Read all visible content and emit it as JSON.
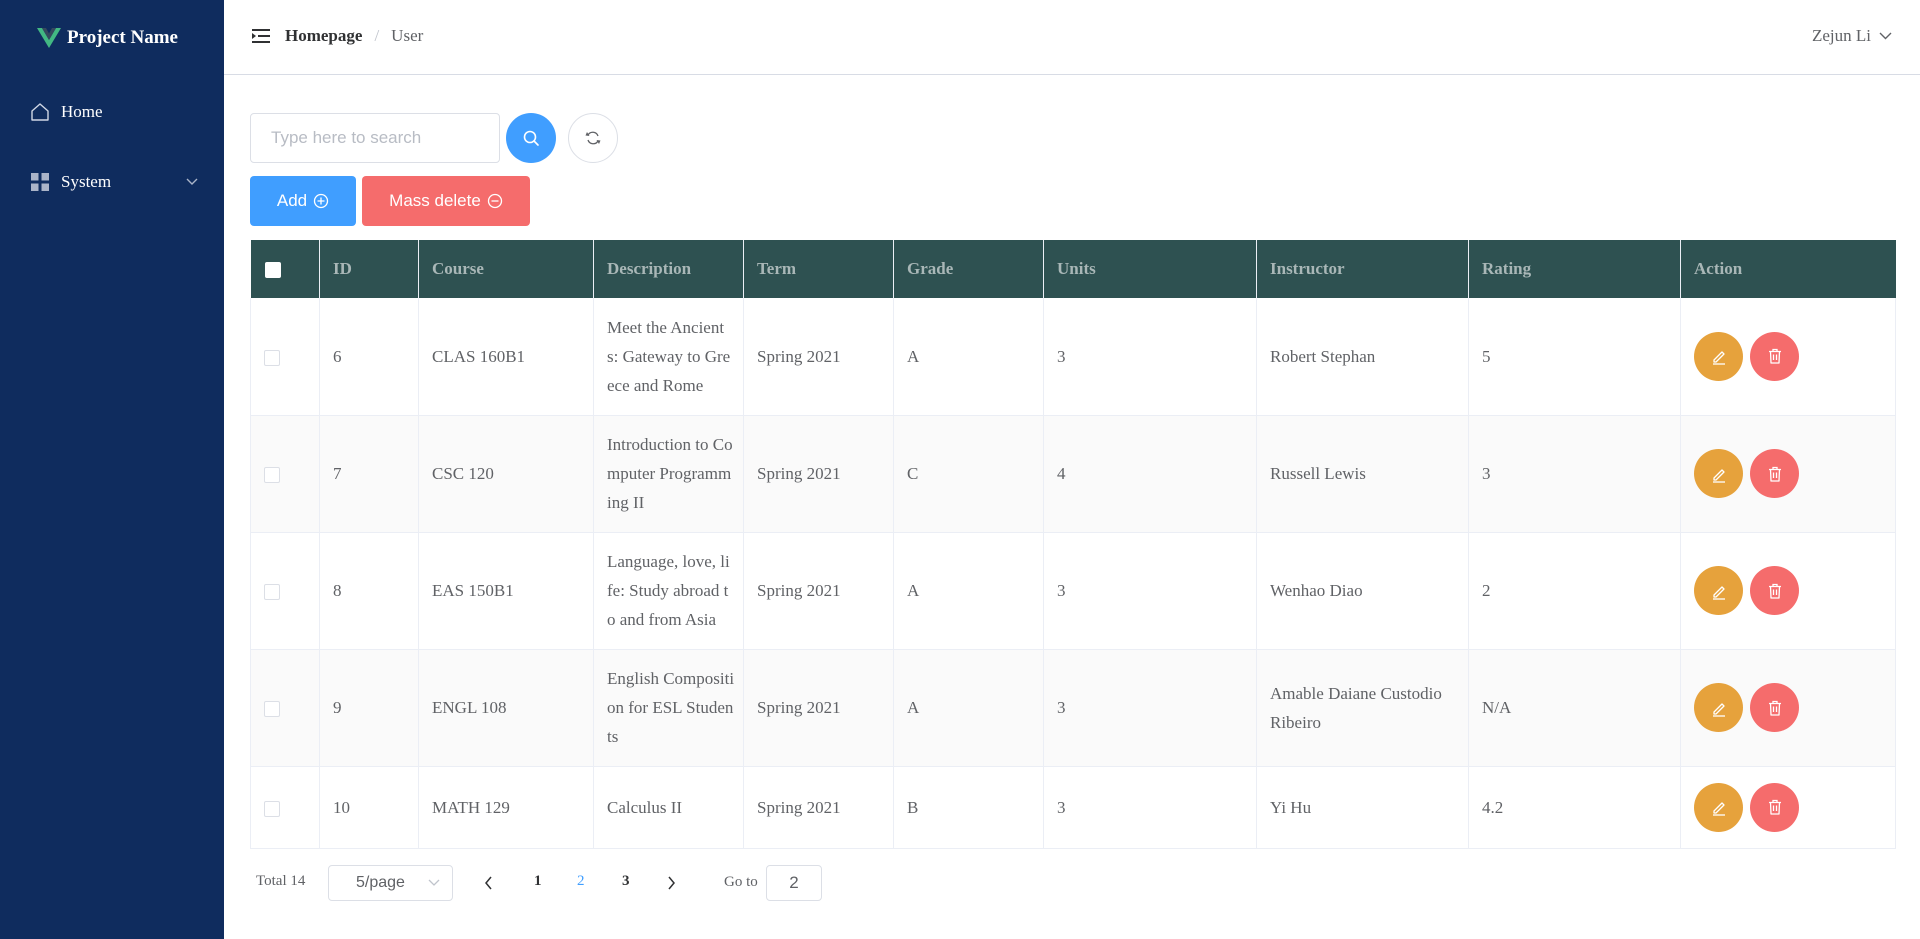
{
  "app": {
    "name": "Project Name",
    "logo_color": "#42b883",
    "sidebar_bg": "#0f2c5e"
  },
  "sidebar": {
    "items": [
      {
        "label": "Home",
        "icon": "home-icon"
      },
      {
        "label": "System",
        "icon": "grid-icon",
        "expandable": true
      }
    ]
  },
  "header": {
    "breadcrumb": {
      "home": "Homepage",
      "separator": "/",
      "current": "User"
    },
    "user_name": "Zejun Li"
  },
  "toolbar": {
    "search_placeholder": "Type here to search",
    "add_label": "Add",
    "mass_delete_label": "Mass delete"
  },
  "table": {
    "header_bg": "#2e5151",
    "columns": [
      "ID",
      "Course",
      "Description",
      "Term",
      "Grade",
      "Units",
      "Instructor",
      "Rating",
      "Action"
    ],
    "rows": [
      {
        "id": "6",
        "course": "CLAS 160B1",
        "description": "Meet the Ancients: Gateway to Greece and Rome",
        "term": "Spring 2021",
        "grade": "A",
        "units": "3",
        "instructor": "Robert Stephan",
        "rating": "5"
      },
      {
        "id": "7",
        "course": "CSC 120",
        "description": "Introduction to Computer Programming II",
        "term": "Spring 2021",
        "grade": "C",
        "units": "4",
        "instructor": "Russell Lewis",
        "rating": "3"
      },
      {
        "id": "8",
        "course": "EAS 150B1",
        "description": "Language, love, life: Study abroad to and from Asia",
        "term": "Spring 2021",
        "grade": "A",
        "units": "3",
        "instructor": "Wenhao Diao",
        "rating": "2"
      },
      {
        "id": "9",
        "course": "ENGL 108",
        "description": "English Composition for ESL Students",
        "term": "Spring 2021",
        "grade": "A",
        "units": "3",
        "instructor": "Amable Daiane Custodio Ribeiro",
        "rating": "N/A"
      },
      {
        "id": "10",
        "course": "MATH 129",
        "description": "Calculus II",
        "term": "Spring 2021",
        "grade": "B",
        "units": "3",
        "instructor": "Yi Hu",
        "rating": "4.2"
      }
    ]
  },
  "pagination": {
    "total_label": "Total 14",
    "page_size": "5/page",
    "pages": [
      "1",
      "2",
      "3"
    ],
    "current_page": "2",
    "goto_label": "Go to",
    "goto_value": "2"
  },
  "colors": {
    "primary": "#409eff",
    "danger": "#f56c6c",
    "warning": "#e6a23c"
  }
}
